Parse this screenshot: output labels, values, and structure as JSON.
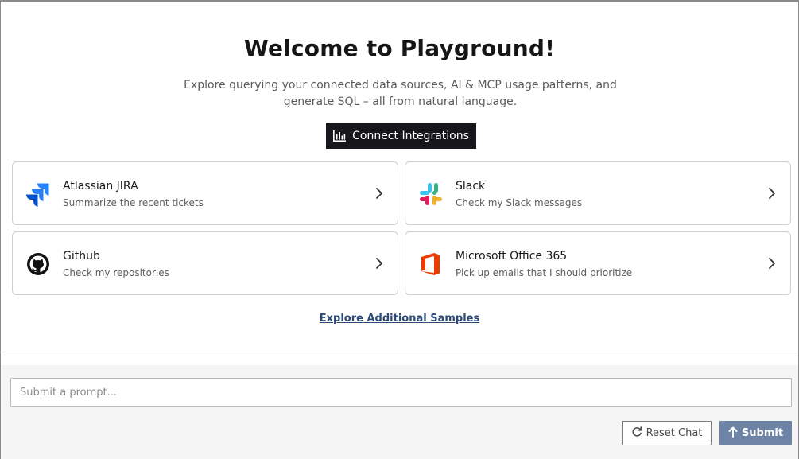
{
  "welcome": {
    "title": "Welcome to Playground!",
    "subtitle": "Explore querying your connected data sources, AI & MCP usage patterns, and generate SQL – all from natural language."
  },
  "connect_button": {
    "label": "Connect Integrations",
    "icon": "bar-chart-icon"
  },
  "cards": [
    {
      "title": "Atlassian JIRA",
      "description": "Summarize the recent tickets",
      "icon": "jira-logo-icon"
    },
    {
      "title": "Slack",
      "description": "Check my Slack messages",
      "icon": "slack-logo-icon"
    },
    {
      "title": "Github",
      "description": "Check my repositories",
      "icon": "github-logo-icon"
    },
    {
      "title": "Microsoft Office 365",
      "description": "Pick up emails that I should prioritize",
      "icon": "office-365-logo-icon"
    }
  ],
  "explore_link": "Explore Additional Samples",
  "prompt": {
    "placeholder": "Submit a prompt...",
    "value": ""
  },
  "buttons": {
    "reset": {
      "label": "Reset Chat",
      "icon": "refresh-icon"
    },
    "submit": {
      "label": "Submit",
      "icon": "arrow-up-icon"
    }
  },
  "colors": {
    "primary_button": "#16161b",
    "submit_button": "#6e84a6",
    "link": "#2b4a78",
    "jira_blue": "#2684ff",
    "office_red": "#eb3c00"
  }
}
